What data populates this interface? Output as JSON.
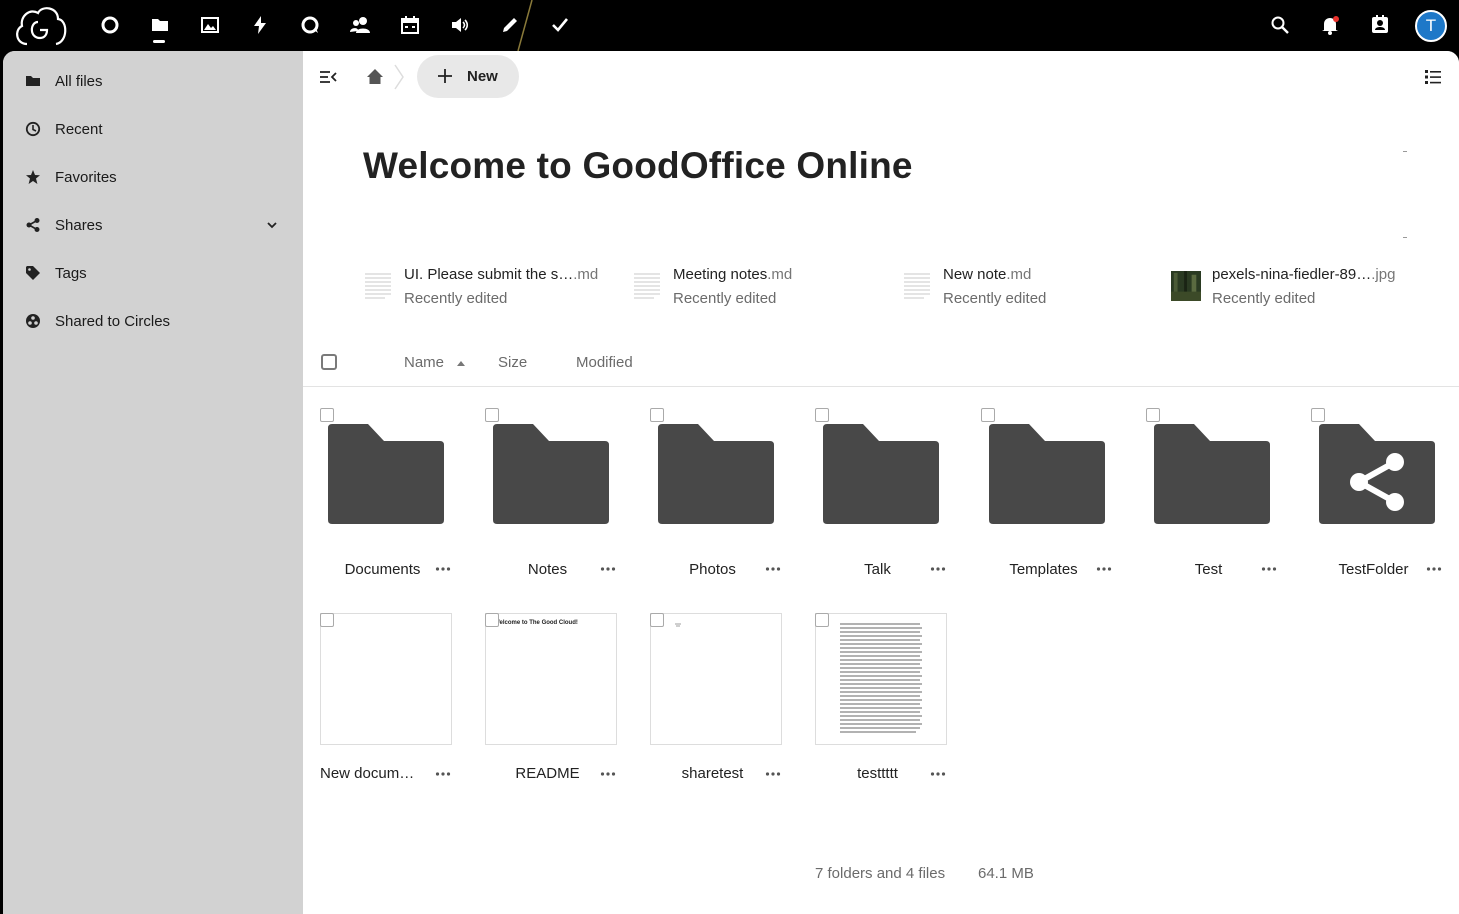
{
  "topbar": {
    "apps": [
      {
        "name": "dashboard-app",
        "icon": "circle-icon"
      },
      {
        "name": "files-app",
        "icon": "folder-icon"
      },
      {
        "name": "photos-app",
        "icon": "image-icon"
      },
      {
        "name": "activity-app",
        "icon": "bolt-icon"
      },
      {
        "name": "talk-app",
        "icon": "chat-icon"
      },
      {
        "name": "contacts-app",
        "icon": "people-icon"
      },
      {
        "name": "calendar-app",
        "icon": "calendar-icon"
      },
      {
        "name": "announcements-app",
        "icon": "speaker-icon"
      },
      {
        "name": "notes-app",
        "icon": "pencil-icon"
      },
      {
        "name": "tasks-app",
        "icon": "checkmark-icon"
      }
    ],
    "avatar_initial": "T"
  },
  "sidebar": {
    "items": [
      {
        "label": "All files",
        "icon": "folder-icon"
      },
      {
        "label": "Recent",
        "icon": "clock-icon"
      },
      {
        "label": "Favorites",
        "icon": "star-icon"
      },
      {
        "label": "Shares",
        "icon": "share-icon"
      },
      {
        "label": "Tags",
        "icon": "tag-icon"
      },
      {
        "label": "Shared to Circles",
        "icon": "circles-icon"
      }
    ]
  },
  "main": {
    "new_label": "New",
    "title": "Welcome to GoodOffice Online",
    "recent": [
      {
        "name": "UI. Please submit the s…",
        "ext": ".md",
        "sub": "Recently edited"
      },
      {
        "name": "Meeting notes",
        "ext": ".md",
        "sub": "Recently edited"
      },
      {
        "name": "New note",
        "ext": ".md",
        "sub": "Recently edited"
      },
      {
        "name": "pexels-nina-fiedler-89…",
        "ext": ".jpg",
        "sub": "Recently edited"
      }
    ],
    "columns": {
      "name": "Name",
      "size": "Size",
      "modified": "Modified"
    },
    "folders": [
      "Documents",
      "Notes",
      "Photos",
      "Talk",
      "Templates",
      "Test",
      "TestFolder"
    ],
    "files": [
      "New docum…",
      "README",
      "sharetest",
      "testtttt"
    ],
    "readme_preview": "Welcome to The Good Cloud!",
    "summary": "7 folders and 4 files",
    "total_size": "64.1 MB"
  },
  "colors": {
    "topbar": "#000000",
    "sidebar": "#d2d2d2",
    "folder": "#484848",
    "avatar": "#1e78c8"
  }
}
